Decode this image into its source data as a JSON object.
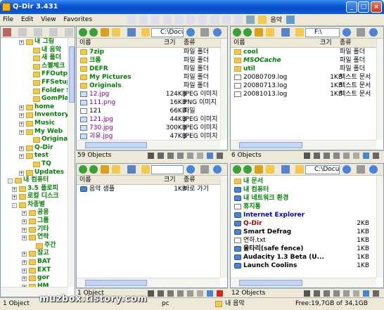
{
  "window": {
    "title": "Q-Dir 3.431"
  },
  "menu": [
    "File",
    "Edit",
    "View",
    "Favorites"
  ],
  "toolbar": {
    "music_label": "음악"
  },
  "tree": {
    "items": [
      {
        "label": "내 그림",
        "exp": "+"
      },
      {
        "label": "내 음악",
        "exp": ""
      },
      {
        "label": "새 폴더",
        "exp": ""
      },
      {
        "label": "스펠체크",
        "exp": ""
      },
      {
        "label": "FFOutput",
        "exp": ""
      },
      {
        "label": "FFSetup",
        "exp": ""
      },
      {
        "label": "Folder Size",
        "exp": ""
      },
      {
        "label": "GomPlayer",
        "exp": ""
      },
      {
        "label": "home",
        "exp": "+"
      },
      {
        "label": "Inventory",
        "exp": "+"
      },
      {
        "label": "Music",
        "exp": "+"
      },
      {
        "label": "My Web",
        "exp": "+"
      },
      {
        "label": "Originals",
        "exp": ""
      },
      {
        "label": "Q-Dir",
        "exp": "+"
      },
      {
        "label": "test",
        "exp": "+"
      },
      {
        "label": "TQ",
        "exp": ""
      },
      {
        "label": "Updates",
        "exp": "+"
      },
      {
        "label": "내 컴퓨터",
        "exp": "-"
      },
      {
        "label": "3.5 플로피",
        "exp": "+"
      },
      {
        "label": "로컬 디스크",
        "exp": "+"
      },
      {
        "label": "차종별",
        "exp": "-"
      },
      {
        "label": "공용",
        "exp": "+"
      },
      {
        "label": "그룹",
        "exp": "+"
      },
      {
        "label": "기타",
        "exp": "+"
      },
      {
        "label": "연락",
        "exp": "+"
      },
      {
        "label": "주간",
        "exp": ""
      },
      {
        "label": "참고",
        "exp": "+"
      },
      {
        "label": "BAT",
        "exp": "+"
      },
      {
        "label": "EXT",
        "exp": "+"
      },
      {
        "label": "gor",
        "exp": "+"
      },
      {
        "label": "HM",
        "exp": "+"
      }
    ]
  },
  "columns": {
    "name": "이름",
    "size": "크기",
    "type": "종류"
  },
  "panes": {
    "tl": {
      "path": "C:\\Docum",
      "status": "59 Objects",
      "rows": [
        {
          "name": "7zip",
          "size": "",
          "type": "파일 폴더",
          "cls": "grn bold",
          "icon": "folder"
        },
        {
          "name": "크롬",
          "size": "",
          "type": "파일 폴더",
          "cls": "grn bold",
          "icon": "folder"
        },
        {
          "name": "DEFR",
          "size": "",
          "type": "파일 폴더",
          "cls": "grn bold",
          "icon": "folder"
        },
        {
          "name": "My Pictures",
          "size": "",
          "type": "파일 폴더",
          "cls": "grn bold",
          "icon": "folder"
        },
        {
          "name": "Originals",
          "size": "",
          "type": "파일 폴더",
          "cls": "grn bold",
          "icon": "folder"
        },
        {
          "name": "12.jpg",
          "size": "124KB",
          "type": "JPEG 이미지",
          "cls": "pur",
          "icon": "img"
        },
        {
          "name": "111.png",
          "size": "16KB",
          "type": "PNG 이미지",
          "cls": "pur",
          "icon": "img"
        },
        {
          "name": "121",
          "size": "66KB",
          "type": "파일",
          "cls": "",
          "icon": "file"
        },
        {
          "name": "121.jpg",
          "size": "44KB",
          "type": "JPEG 이미지",
          "cls": "pur",
          "icon": "img"
        },
        {
          "name": "730.jpg",
          "size": "300KB",
          "type": "JPEG 이미지",
          "cls": "pur",
          "icon": "img"
        },
        {
          "name": "괴유.jpg",
          "size": "47KB",
          "type": "JPEG 이미지",
          "cls": "pur",
          "icon": "img"
        }
      ]
    },
    "tr": {
      "path": "F:\\",
      "status": "6 Objects",
      "rows": [
        {
          "name": "cool",
          "size": "",
          "type": "파일 폴더",
          "cls": "grn bold",
          "icon": "folder"
        },
        {
          "name": "MSOCache",
          "size": "",
          "type": "파일 폴더",
          "cls": "grn bold it",
          "icon": "folder"
        },
        {
          "name": "util",
          "size": "",
          "type": "파일 폴더",
          "cls": "grn bold",
          "icon": "folder"
        },
        {
          "name": "20080709.log",
          "size": "1KB",
          "type": "텍스트 문서",
          "cls": "",
          "icon": "file"
        },
        {
          "name": "20080713.log",
          "size": "1KB",
          "type": "텍스트 문서",
          "cls": "",
          "icon": "file"
        },
        {
          "name": "20081013.log",
          "size": "1KB",
          "type": "텍스트 문서",
          "cls": "",
          "icon": "file"
        }
      ]
    },
    "bl": {
      "path": "",
      "status": "1 Object",
      "rows": [
        {
          "name": "음악 샘플",
          "size": "1KB",
          "type": "바로 가기",
          "cls": "",
          "icon": "app"
        }
      ]
    },
    "br": {
      "path": "C:\\Docum",
      "status": "12 Objects",
      "rows": [
        {
          "name": "내 문서",
          "size": "",
          "type": "",
          "cls": "grn bold",
          "icon": "folder"
        },
        {
          "name": "내 컴퓨터",
          "size": "",
          "type": "",
          "cls": "grn bold",
          "icon": "app"
        },
        {
          "name": "내 네트워크 환경",
          "size": "",
          "type": "",
          "cls": "grn bold",
          "icon": "app"
        },
        {
          "name": "휴지통",
          "size": "",
          "type": "",
          "cls": "grn bold",
          "icon": "file"
        },
        {
          "name": "Internet Explorer",
          "size": "",
          "type": "",
          "cls": "blu bold",
          "icon": "app"
        },
        {
          "name": "Q-Dir",
          "size": "2KB",
          "type": "",
          "cls": "red bold",
          "icon": "app"
        },
        {
          "name": "Smart Defrag",
          "size": "1KB",
          "type": "",
          "cls": "bold",
          "icon": "app"
        },
        {
          "name": "연하.txt",
          "size": "1KB",
          "type": "",
          "cls": "",
          "icon": "file"
        },
        {
          "name": "울타리(safe fence)",
          "size": "1KB",
          "type": "",
          "cls": "bold",
          "icon": "app"
        },
        {
          "name": "Audacity 1.3 Beta (U...",
          "size": "1KB",
          "type": "",
          "cls": "bold",
          "icon": "app"
        },
        {
          "name": "Launch Coolins",
          "size": "1KB",
          "type": "",
          "cls": "bold",
          "icon": "app"
        }
      ]
    }
  },
  "status": {
    "objects": "1 Object",
    "pc": "pc",
    "folder": "내 음악",
    "free": "Free:19,7GB of 34,1GB"
  },
  "watermark": "muzbox.tistory.com"
}
